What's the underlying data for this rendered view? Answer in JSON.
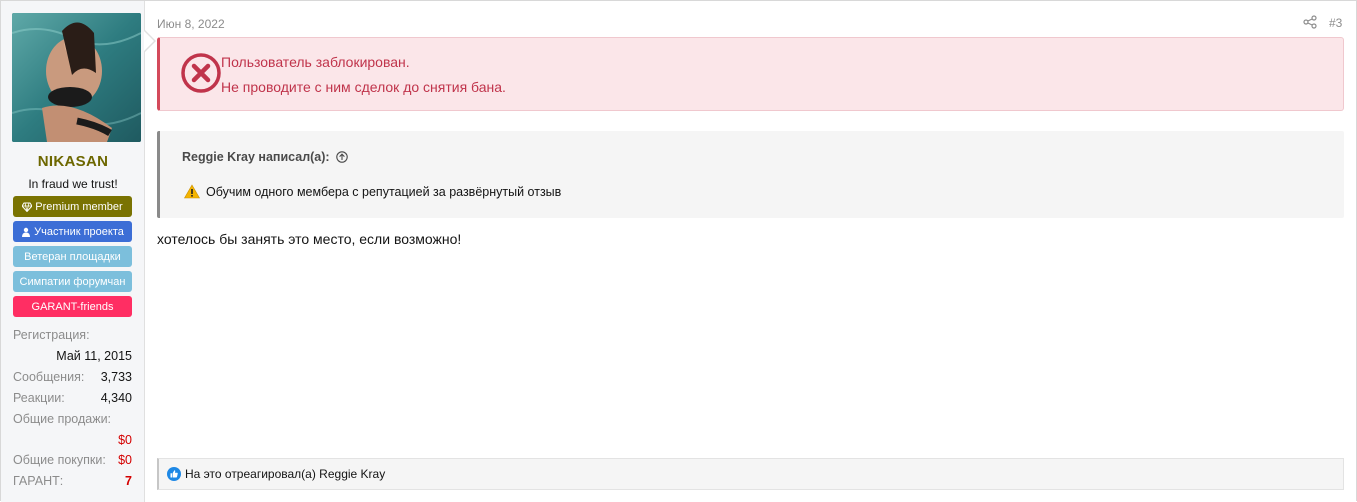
{
  "user": {
    "username": "NIKASAN",
    "title": "In fraud we trust!",
    "banners": [
      {
        "label": "Premium member",
        "icon": "diamond-icon"
      },
      {
        "label": "Участник проекта",
        "icon": "user-icon"
      },
      {
        "label": "Ветеран площадки"
      },
      {
        "label": "Симпатии форумчан"
      },
      {
        "label": "GARANT-friends"
      }
    ],
    "stats": {
      "registration_label": "Регистрация:",
      "registration_value": "Май 11, 2015",
      "messages_label": "Сообщения:",
      "messages_value": "3,733",
      "reactions_label": "Реакции:",
      "reactions_value": "4,340",
      "sales_label": "Общие продажи:",
      "sales_value": "$0",
      "purchases_label": "Общие покупки:",
      "purchases_value": "$0",
      "garant_label": "ГАРАНТ:",
      "garant_value": "7"
    }
  },
  "post": {
    "date": "Июн 8, 2022",
    "number": "#3",
    "ban_line1": "Пользователь заблокирован.",
    "ban_line2": "Не проводите с ним сделок до снятия бана.",
    "quote_author": "Reggie Kray написал(а):",
    "quote_text": "Обучим одного мембера с репутацией за развёрнутый отзыв",
    "body": "хотелось бы занять это место, если возможно!",
    "reactions_text": "На это отреагировал(а) Reggie Kray"
  },
  "colors": {
    "username": "#6d6700",
    "ban_text": "#c0344b",
    "ban_bg": "#fbe6e9",
    "premium_banner": "#7a7302",
    "member_banner": "#3c6ed6",
    "veteran_banner": "#7cbfdc",
    "garant_banner": "#ff2e63",
    "money_red": "#d40000"
  }
}
